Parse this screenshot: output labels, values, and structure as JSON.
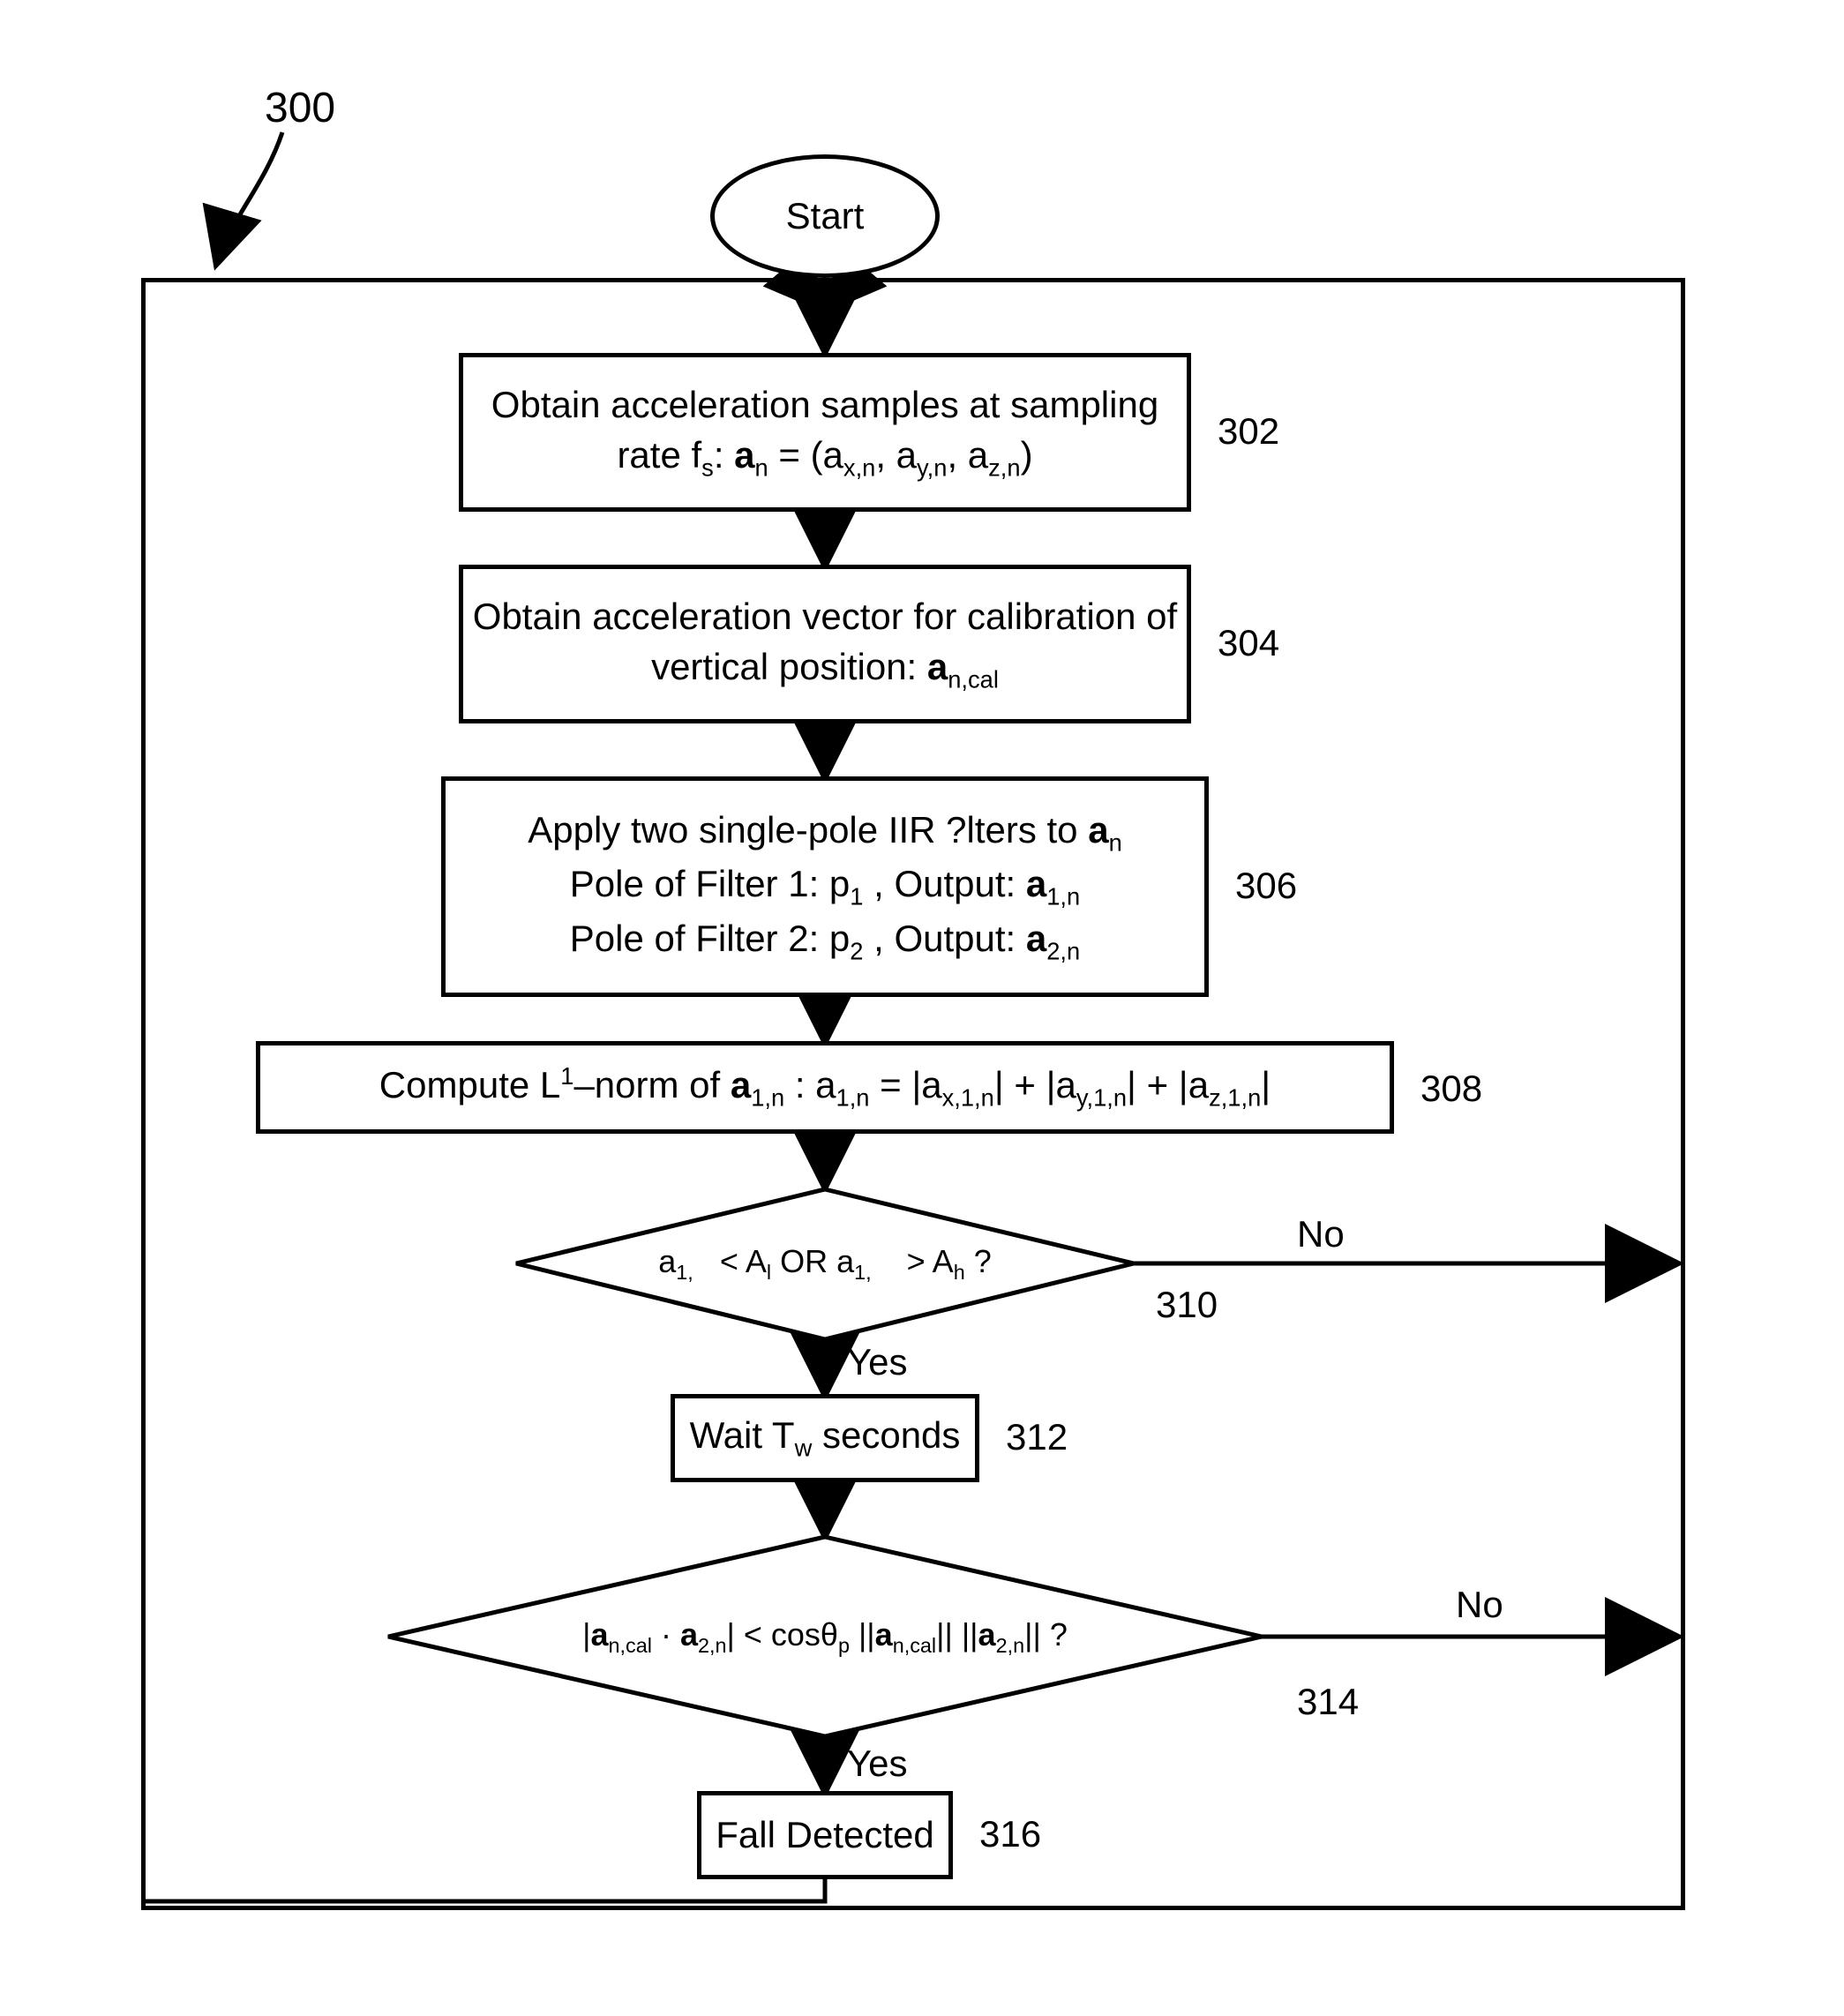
{
  "labels": {
    "figure": "300",
    "start": "Start",
    "step302": "Obtain acceleration samples at sampling rate f<sub>s</sub>: <b>a</b><sub>n</sub> = (a<sub>x,n</sub>, a<sub>y,n</sub>, a<sub>z,n</sub>)",
    "step304": "Obtain acceleration vector for calibration of vertical position: <b>a</b><sub>n,cal</sub>",
    "step306": "Apply two single-pole IIR ?lters to <b>a</b><sub>n</sub><br>Pole of Filter 1: p<sub>1</sub> , Output: <b>a</b><sub>1,n</sub><br>Pole of Filter 2: p<sub>2</sub> , Output: <b>a</b><sub>2,n</sub>",
    "step308": "Compute L<sup>1</sup>–norm of <b>a</b><sub>1,n</sub> : a<sub>1,n</sub> = |a<sub>x,1,n</sub>| + |a<sub>y,1,n</sub>| + |a<sub>z,1,n</sub>|",
    "dec310": "a<sub>1,</sub>&nbsp;&nbsp; &lt; A<sub>l</sub> OR a<sub>1,</sub>&nbsp;&nbsp;&nbsp; &gt; A<sub>h</sub> ?",
    "step312": "Wait T<sub>w</sub> seconds",
    "dec314": "|<b>a</b><sub>n,cal</sub> · <b>a</b><sub>2,n</sub>| &lt; cosθ<sub>p</sub> ||<b>a</b><sub>n,cal</sub>|| ||<b>a</b><sub>2,n</sub>|| ?",
    "step316": "Fall Detected",
    "yes": "Yes",
    "no": "No"
  },
  "refs": {
    "r302": "302",
    "r304": "304",
    "r306": "306",
    "r308": "308",
    "r310": "310",
    "r312": "312",
    "r314": "314",
    "r316": "316"
  },
  "chart_data": {
    "type": "flowchart",
    "title": "300",
    "nodes": [
      {
        "id": "start",
        "type": "terminator",
        "label": "Start"
      },
      {
        "id": "302",
        "type": "process",
        "label": "Obtain acceleration samples at sampling rate f_s: a_n = (a_{x,n}, a_{y,n}, a_{z,n})"
      },
      {
        "id": "304",
        "type": "process",
        "label": "Obtain acceleration vector for calibration of vertical position: a_{n,cal}"
      },
      {
        "id": "306",
        "type": "process",
        "label": "Apply two single-pole IIR filters to a_n. Pole of Filter 1: p_1, Output: a_{1,n}. Pole of Filter 2: p_2, Output: a_{2,n}"
      },
      {
        "id": "308",
        "type": "process",
        "label": "Compute L1-norm of a_{1,n}: a_{1,n} = |a_{x,1,n}| + |a_{y,1,n}| + |a_{z,1,n}|"
      },
      {
        "id": "310",
        "type": "decision",
        "label": "a_{1,} < A_l OR a_{1,} > A_h ?"
      },
      {
        "id": "312",
        "type": "process",
        "label": "Wait T_w seconds"
      },
      {
        "id": "314",
        "type": "decision",
        "label": "|a_{n,cal} · a_{2,n}| < cos(theta_p) ||a_{n,cal}|| ||a_{2,n}|| ?"
      },
      {
        "id": "316",
        "type": "process",
        "label": "Fall Detected"
      }
    ],
    "edges": [
      {
        "from": "start",
        "to": "302"
      },
      {
        "from": "302",
        "to": "304"
      },
      {
        "from": "304",
        "to": "306"
      },
      {
        "from": "306",
        "to": "308"
      },
      {
        "from": "308",
        "to": "310"
      },
      {
        "from": "310",
        "to": "312",
        "label": "Yes"
      },
      {
        "from": "310",
        "to": "302",
        "label": "No",
        "route": "right-then-up-loop"
      },
      {
        "from": "312",
        "to": "314"
      },
      {
        "from": "314",
        "to": "316",
        "label": "Yes"
      },
      {
        "from": "314",
        "to": "302",
        "label": "No",
        "route": "right-then-up-loop"
      },
      {
        "from": "316",
        "to": "302",
        "route": "down-left-up-loop"
      }
    ]
  }
}
